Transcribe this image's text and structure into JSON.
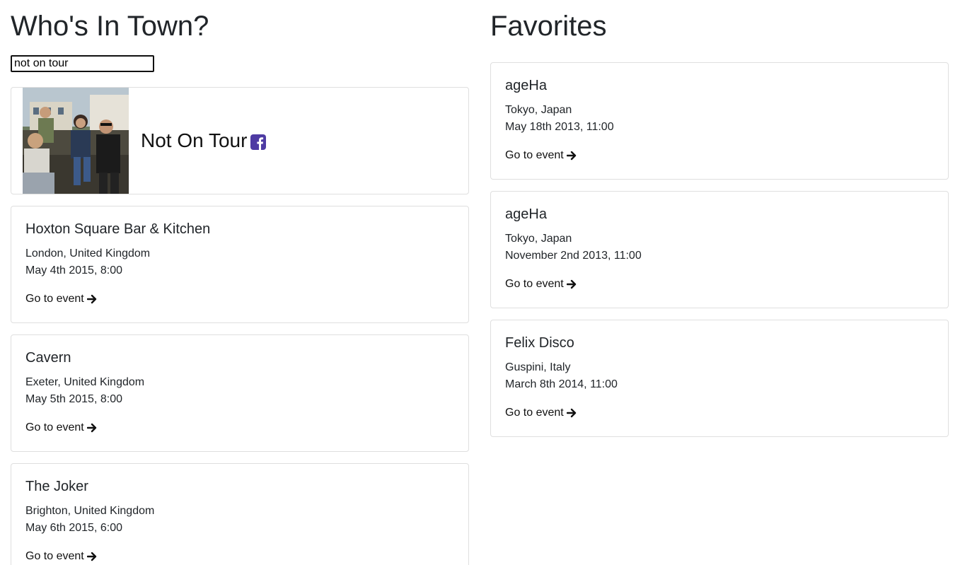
{
  "left": {
    "title": "Who's In Town?",
    "search": {
      "value": "not on tour",
      "placeholder": ""
    },
    "artist": {
      "name": "Not On Tour",
      "photo_icon": "band-photo",
      "social_icon": "facebook-icon"
    },
    "events": [
      {
        "venue": "Hoxton Square Bar & Kitchen",
        "place": "London, United Kingdom",
        "date": "May 4th 2015, 8:00",
        "link_label": "Go to event"
      },
      {
        "venue": "Cavern",
        "place": "Exeter, United Kingdom",
        "date": "May 5th 2015, 8:00",
        "link_label": "Go to event"
      },
      {
        "venue": "The Joker",
        "place": "Brighton, United Kingdom",
        "date": "May 6th 2015, 6:00",
        "link_label": "Go to event"
      }
    ]
  },
  "right": {
    "title": "Favorites",
    "events": [
      {
        "venue": "ageHa",
        "place": "Tokyo, Japan",
        "date": "May 18th 2013, 11:00",
        "link_label": "Go to event"
      },
      {
        "venue": "ageHa",
        "place": "Tokyo, Japan",
        "date": "November 2nd 2013, 11:00",
        "link_label": "Go to event"
      },
      {
        "venue": "Felix Disco",
        "place": "Guspini, Italy",
        "date": "March 8th 2014, 11:00",
        "link_label": "Go to event"
      }
    ]
  },
  "colors": {
    "facebook": "#4e3ba3",
    "card_border": "#dfdfdf",
    "text": "#212529"
  }
}
